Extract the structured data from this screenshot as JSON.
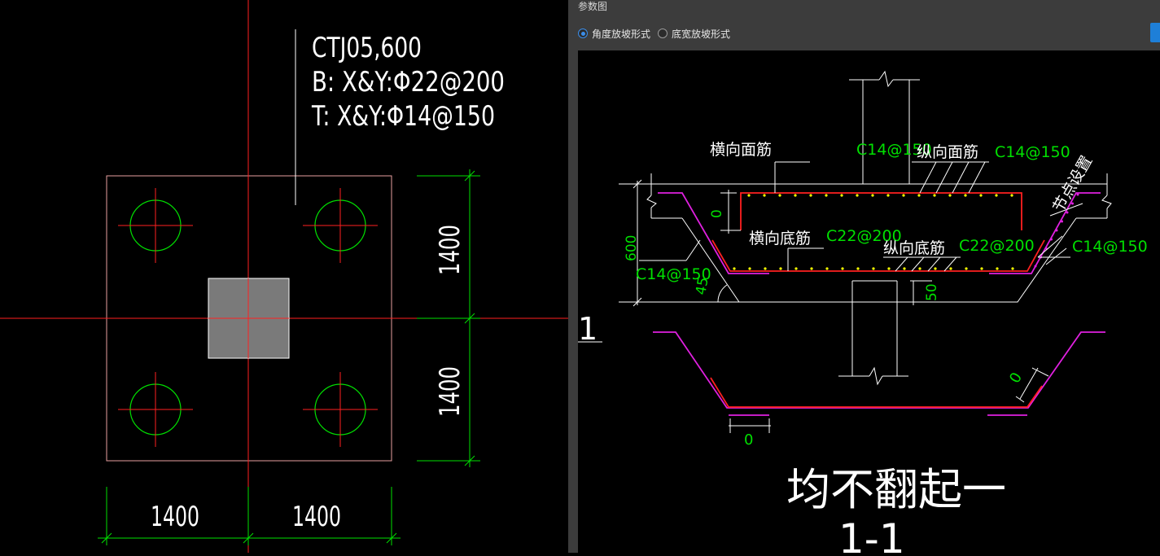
{
  "cad": {
    "label_line1": "CTJ05,600",
    "label_line2": "B: X&Y:Φ22@200",
    "label_line3": "T: X&Y:Φ14@150",
    "dim_vertical_top": "1400",
    "dim_vertical_bottom": "1400",
    "dim_horizontal_left": "1400",
    "dim_horizontal_right": "1400"
  },
  "panel": {
    "title": "参数图",
    "radio_angle": "角度放坡形式",
    "radio_width": "底宽放坡形式",
    "selected": "角度放坡形式"
  },
  "diagram": {
    "label_trans_top": "横向面筋",
    "val_trans_top": "C14@150",
    "label_long_top": "纵向面筋",
    "val_long_top": "C14@150",
    "label_node": "节点设置",
    "label_trans_bottom": "横向底筋",
    "val_trans_bottom": "C22@200",
    "label_long_bottom": "纵向底筋",
    "val_long_bottom": "C22@200",
    "val_slope_right": "C14@150",
    "val_slope_left": "C14@150",
    "dim_600": "600",
    "dim_0_top": "0",
    "dim_45": "45",
    "dim_50": "50",
    "dim_0_bottom": "0",
    "dim_0_right": "0",
    "marker_1": "1",
    "big_caption": "均不翻起一",
    "section_label": "1-1"
  },
  "colors": {
    "red": "#ff2020",
    "green": "#00e000",
    "magenta": "#e020e0",
    "white": "#ffffff",
    "yellow": "#ffff00",
    "pile_fill": "#7a7a7a",
    "accent_blue": "#3b8eea"
  }
}
